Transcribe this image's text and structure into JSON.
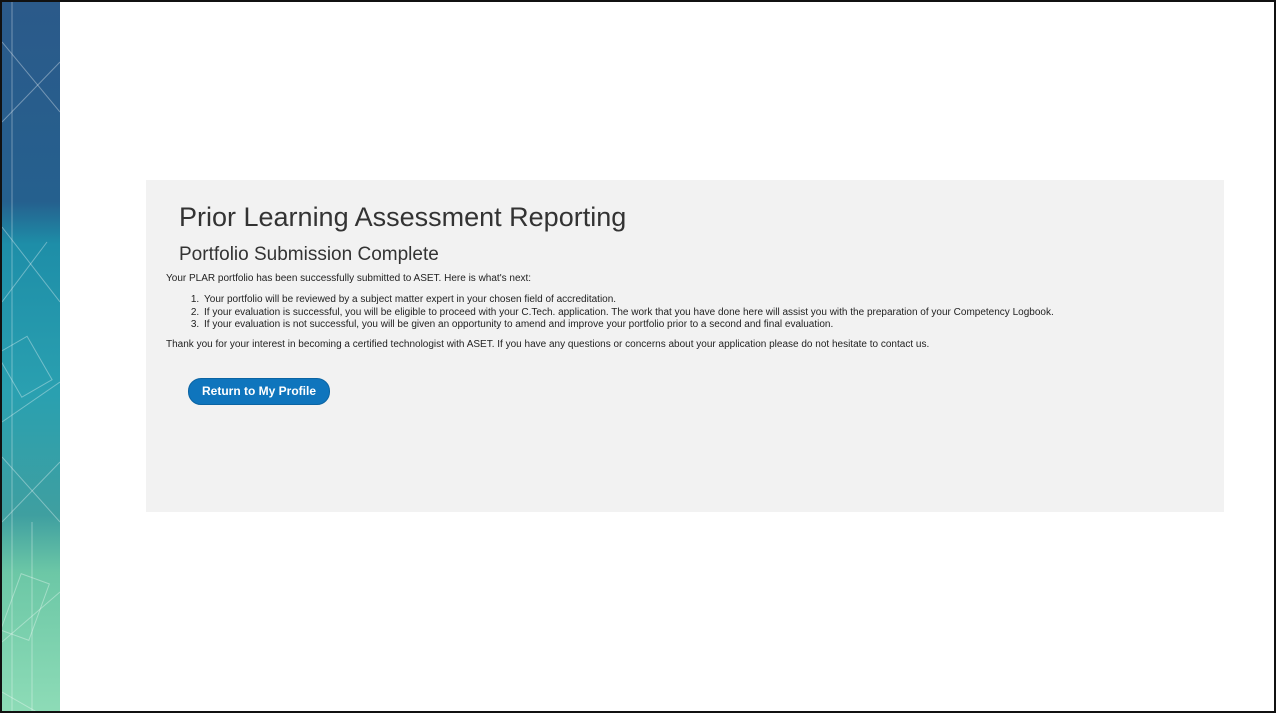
{
  "report": {
    "title": "Prior Learning Assessment Reporting",
    "subtitle": "Portfolio Submission Complete",
    "intro": "Your PLAR portfolio has been successfully submitted to ASET. Here is what's next:",
    "steps": [
      "Your portfolio will be reviewed by a subject matter expert in your chosen field of accreditation.",
      "If your evaluation is successful, you will be eligible to proceed with your C.Tech. application. The work that you have done here will assist you with the preparation of your Competency Logbook.",
      "If your evaluation is not successful, you will be given an opportunity to amend and improve your portfolio prior to a second and final evaluation."
    ],
    "closing": "Thank you for your interest in becoming a certified technologist with ASET. If you have any questions or concerns about your application please do not hesitate to contact us.",
    "return_button": "Return to My Profile"
  },
  "colors": {
    "panel_background": "#f2f2f2",
    "button": "#0f75bd",
    "strip_top": "#2a5d8c",
    "strip_middle": "#1f8aa6",
    "strip_bottom": "#7fd3b0"
  }
}
